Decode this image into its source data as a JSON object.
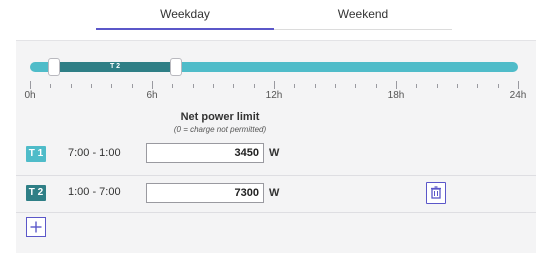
{
  "tabs": {
    "weekday": "Weekday",
    "weekend": "Weekend",
    "active": "Weekday"
  },
  "timeline": {
    "segment_label": "T 2",
    "tick_labels": [
      "0h",
      "6h",
      "12h",
      "18h",
      "24h"
    ]
  },
  "limit_header": {
    "title": "Net power limit",
    "subtitle": "(0 = charge not permitted)"
  },
  "rows": [
    {
      "badge": "T 1",
      "time_range": "7:00 - 1:00",
      "value": "3450",
      "unit": "W"
    },
    {
      "badge": "T 2",
      "time_range": "1:00 - 7:00",
      "value": "7300",
      "unit": "W"
    }
  ],
  "colors": {
    "accent": "#5b57c9",
    "t1": "#4fbcc9",
    "t2": "#2f7f86"
  },
  "icons": {
    "delete": "trash-icon",
    "add": "plus-icon"
  }
}
